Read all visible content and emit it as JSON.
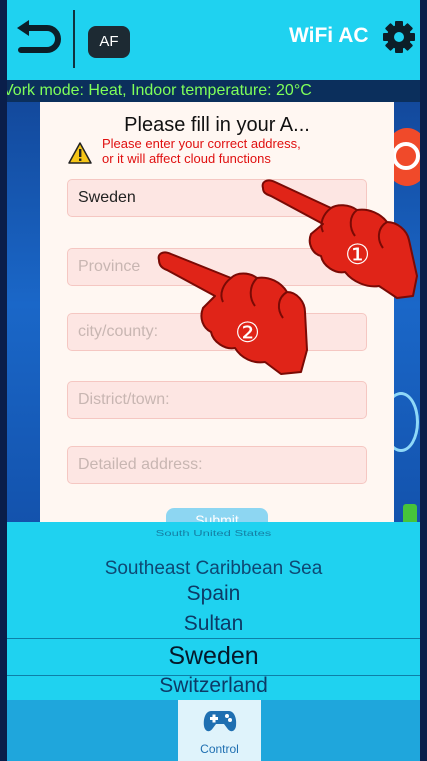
{
  "header": {
    "af_label": "AF",
    "title": "WiFi AC"
  },
  "status_text": "Vork mode: Heat,  Indoor temperature: 20°C",
  "dialog": {
    "title": "Please fill in your A...",
    "warning_line1": "Please enter your correct address,",
    "warning_line2": "or it will affect cloud functions",
    "country_value": "Sweden",
    "province_placeholder": "Province",
    "city_placeholder": "city/county:",
    "district_placeholder": "District/town:",
    "detail_placeholder": "Detailed address:",
    "submit_label": "Submit"
  },
  "picker": {
    "items": [
      "South United States",
      "Southeast Caribbean Sea",
      "Spain",
      "Sultan",
      "Sweden",
      "Switzerland"
    ],
    "selected": "Sweden"
  },
  "bottom_nav": {
    "control_label": "Control"
  },
  "annotations": {
    "step1": "①",
    "step2": "②"
  },
  "colors": {
    "header_bg": "#1fd2f0",
    "status_text": "#7fff5a",
    "warning_text": "#e01010",
    "hand": "#e02418",
    "field_bg": "#fde6e3"
  },
  "icons": [
    "back-arrow-icon",
    "gear-icon",
    "warning-triangle-icon",
    "gamepad-icon",
    "pointing-hand-icon"
  ]
}
